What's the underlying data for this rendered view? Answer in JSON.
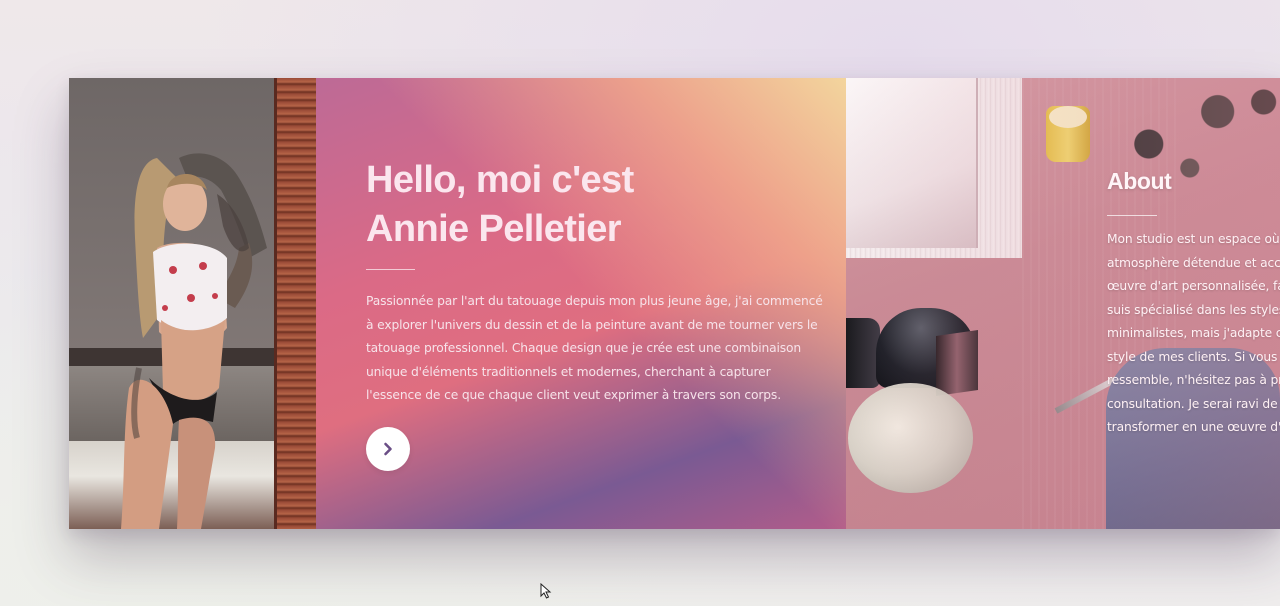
{
  "intro": {
    "title_line1": "Hello, moi c'est",
    "title_line2": "Annie Pelletier",
    "text_lines": [
      "Passionnée par l'art du tatouage depuis mon plus jeune âge, j'ai commencé",
      "à explorer l'univers du dessin et de la peinture avant de me tourner vers le",
      "tatouage professionnel. Chaque design que je crée est une combinaison",
      "unique d'éléments traditionnels et modernes, cherchant à capturer",
      "l'essence de ce que chaque client veut exprimer à travers son corps."
    ],
    "next_icon": "chevron-right-icon"
  },
  "about": {
    "title": "About",
    "text_lines": [
      "Mon studio est un espace où la",
      "atmosphère détendue et accue",
      "œuvre d'art personnalisée, fait",
      "suis spécialisé dans les styles g",
      "minimalistes, mais j'adapte cha",
      "style de mes clients. Si vous ch",
      "ressemble, n'hésitez pas à pren",
      "consultation. Je serai ravi de",
      "transformer en une œuvre d'ar"
    ]
  },
  "colors": {
    "gradient_warm": "#f3d59d",
    "gradient_pink": "#df6e80",
    "gradient_purple": "#7a5a93",
    "button_bg": "#ffffff",
    "button_icon": "#6a4e86"
  }
}
